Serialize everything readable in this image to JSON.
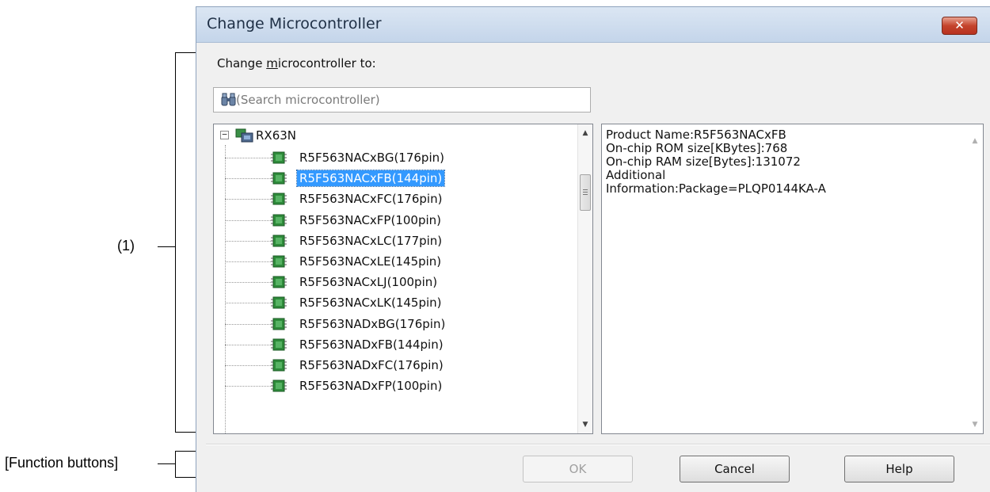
{
  "annotations": {
    "region_1": "(1)",
    "function_buttons": "[Function buttons]"
  },
  "dialog": {
    "title": "Change Microcontroller",
    "close_label": "✕",
    "change_label_prefix": "Change ",
    "change_label_mnemonic": "m",
    "change_label_suffix": "icrocontroller to:",
    "search": {
      "placeholder": "(Search microcontroller)"
    },
    "tree": {
      "root": {
        "expander": "−",
        "label": "RX63N"
      },
      "items": [
        {
          "label": "R5F563NACxBG(176pin)",
          "selected": false
        },
        {
          "label": "R5F563NACxFB(144pin)",
          "selected": true
        },
        {
          "label": "R5F563NACxFC(176pin)",
          "selected": false
        },
        {
          "label": "R5F563NACxFP(100pin)",
          "selected": false
        },
        {
          "label": "R5F563NACxLC(177pin)",
          "selected": false
        },
        {
          "label": "R5F563NACxLE(145pin)",
          "selected": false
        },
        {
          "label": "R5F563NACxLJ(100pin)",
          "selected": false
        },
        {
          "label": "R5F563NACxLK(145pin)",
          "selected": false
        },
        {
          "label": "R5F563NADxBG(176pin)",
          "selected": false
        },
        {
          "label": "R5F563NADxFB(144pin)",
          "selected": false
        },
        {
          "label": "R5F563NADxFC(176pin)",
          "selected": false
        },
        {
          "label": "R5F563NADxFP(100pin)",
          "selected": false
        }
      ]
    },
    "info": {
      "lines": [
        "Product Name:R5F563NACxFB",
        "On-chip ROM size[KBytes]:768",
        "On-chip RAM size[Bytes]:131072",
        "Additional",
        "Information:Package=PLQP0144KA-A"
      ]
    },
    "buttons": {
      "ok": "OK",
      "cancel": "Cancel",
      "help": "Help"
    },
    "scroll_arrows": {
      "up": "▲",
      "down": "▼"
    }
  },
  "colors": {
    "selection": "#3399ff",
    "chip_icon": "#2e8b3a",
    "close_button": "#c4442c"
  }
}
